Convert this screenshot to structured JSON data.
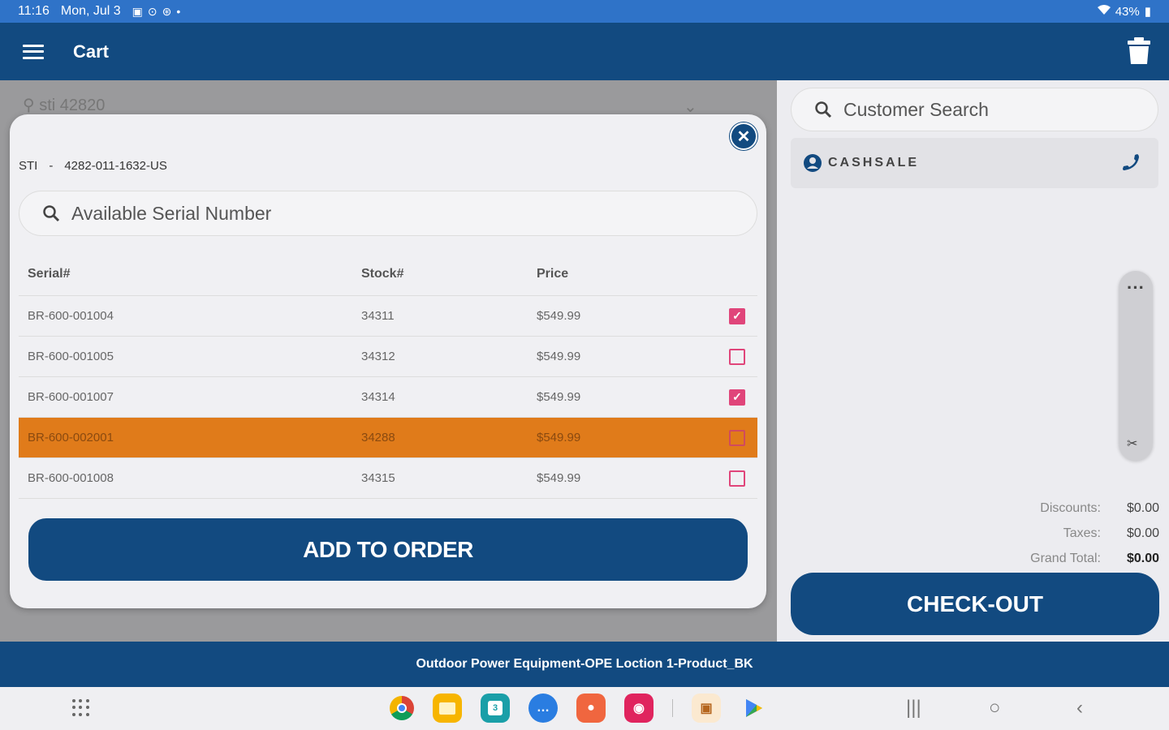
{
  "status_bar": {
    "time": "11:16",
    "date": "Mon, Jul 3",
    "battery": "43%"
  },
  "app_bar": {
    "title": "Cart"
  },
  "background": {
    "search_text": "sti 42820"
  },
  "modal": {
    "brand": "STI",
    "separator": "-",
    "part_number": "4282-011-1632-US",
    "search_placeholder": "Available Serial Number",
    "columns": [
      "Serial#",
      "Stock#",
      "Price"
    ],
    "rows": [
      {
        "serial": "BR-600-001004",
        "stock": "34311",
        "price": "$549.99",
        "checked": true,
        "selected": false
      },
      {
        "serial": "BR-600-001005",
        "stock": "34312",
        "price": "$549.99",
        "checked": false,
        "selected": false
      },
      {
        "serial": "BR-600-001007",
        "stock": "34314",
        "price": "$549.99",
        "checked": true,
        "selected": false
      },
      {
        "serial": "BR-600-002001",
        "stock": "34288",
        "price": "$549.99",
        "checked": false,
        "selected": true
      },
      {
        "serial": "BR-600-001008",
        "stock": "34315",
        "price": "$549.99",
        "checked": false,
        "selected": false
      }
    ],
    "add_button": "ADD TO ORDER"
  },
  "customer": {
    "search_placeholder": "Customer Search",
    "name": "CASHSALE"
  },
  "totals": {
    "discounts_label": "Discounts:",
    "discounts_value": "$0.00",
    "taxes_label": "Taxes:",
    "taxes_value": "$0.00",
    "grand_label": "Grand Total:",
    "grand_value": "$0.00"
  },
  "checkout_button": "CHECK-OUT",
  "footer": {
    "location": "Outdoor Power Equipment-OPE Loction 1-Product_BK"
  },
  "colors": {
    "primary": "#124a80",
    "status_bar": "#2f73c8",
    "selected_row": "#e07b1a",
    "checkbox": "#e0457a"
  },
  "dock_apps": [
    "chrome-icon",
    "files-icon",
    "calendar-icon",
    "messages-icon",
    "contacts-icon",
    "camera-icon",
    "store-icon",
    "play-store-icon"
  ]
}
